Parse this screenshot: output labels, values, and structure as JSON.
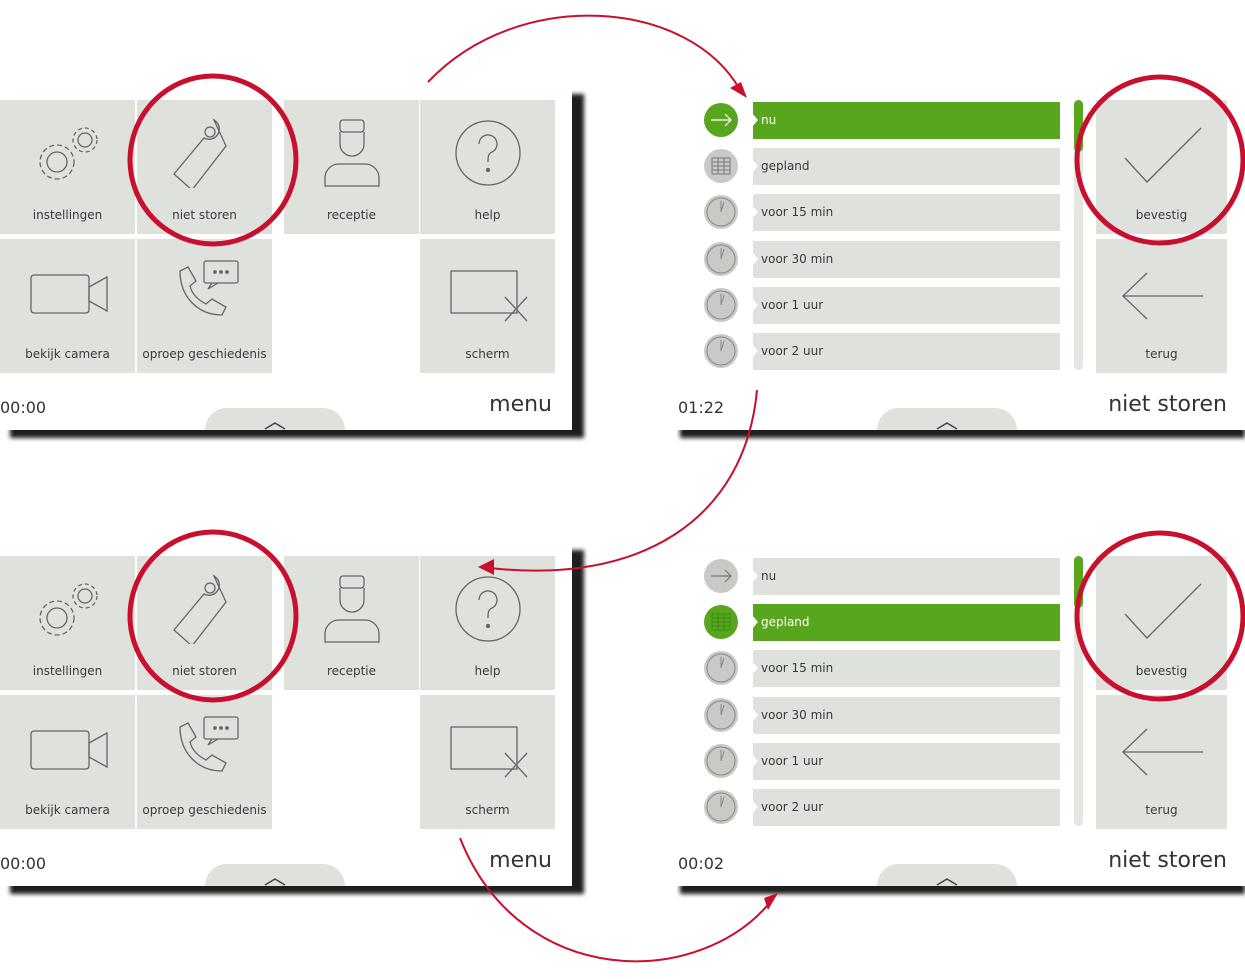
{
  "colors": {
    "accent_green": "#58a51e",
    "tile_gray": "#dfe1dd",
    "annotation_red": "#c8102e"
  },
  "screens": [
    {
      "kind": "menu",
      "clock": "00:00",
      "title": "menu",
      "tiles": [
        {
          "label": "instellingen",
          "icon": "gears-icon"
        },
        {
          "label": "niet storen",
          "icon": "door-hanger-icon"
        },
        {
          "label": "receptie",
          "icon": "receptionist-icon"
        },
        {
          "label": "help",
          "icon": "help-icon"
        },
        {
          "label": "bekijk camera",
          "icon": "camera-icon"
        },
        {
          "label": "oproep geschiedenis",
          "icon": "call-history-icon"
        },
        {
          "label": "scherm",
          "icon": "screen-off-icon"
        }
      ]
    },
    {
      "kind": "list",
      "clock": "01:22",
      "title": "niet storen",
      "selected_index": 0,
      "rows": [
        {
          "label": "nu",
          "icon": "arrow-right-icon"
        },
        {
          "label": "gepland",
          "icon": "calendar-grid-icon"
        },
        {
          "label": "voor 15 min",
          "icon": "clock-icon"
        },
        {
          "label": "voor 30 min",
          "icon": "clock-icon"
        },
        {
          "label": "voor 1 uur",
          "icon": "clock-icon"
        },
        {
          "label": "voor 2 uur",
          "icon": "clock-icon"
        }
      ],
      "confirm_label": "bevestig",
      "back_label": "terug"
    },
    {
      "kind": "menu",
      "clock": "00:00",
      "title": "menu",
      "tiles": [
        {
          "label": "instellingen",
          "icon": "gears-icon"
        },
        {
          "label": "niet storen",
          "icon": "door-hanger-icon"
        },
        {
          "label": "receptie",
          "icon": "receptionist-icon"
        },
        {
          "label": "help",
          "icon": "help-icon"
        },
        {
          "label": "bekijk camera",
          "icon": "camera-icon"
        },
        {
          "label": "oproep geschiedenis",
          "icon": "call-history-icon"
        },
        {
          "label": "scherm",
          "icon": "screen-off-icon"
        }
      ]
    },
    {
      "kind": "list",
      "clock": "00:02",
      "title": "niet storen",
      "selected_index": 1,
      "rows": [
        {
          "label": "nu",
          "icon": "arrow-right-icon"
        },
        {
          "label": "gepland",
          "icon": "calendar-grid-icon"
        },
        {
          "label": "voor 15 min",
          "icon": "clock-icon"
        },
        {
          "label": "voor 30 min",
          "icon": "clock-icon"
        },
        {
          "label": "voor 1 uur",
          "icon": "clock-icon"
        },
        {
          "label": "voor 2 uur",
          "icon": "clock-icon"
        }
      ],
      "confirm_label": "bevestig",
      "back_label": "terug"
    }
  ]
}
